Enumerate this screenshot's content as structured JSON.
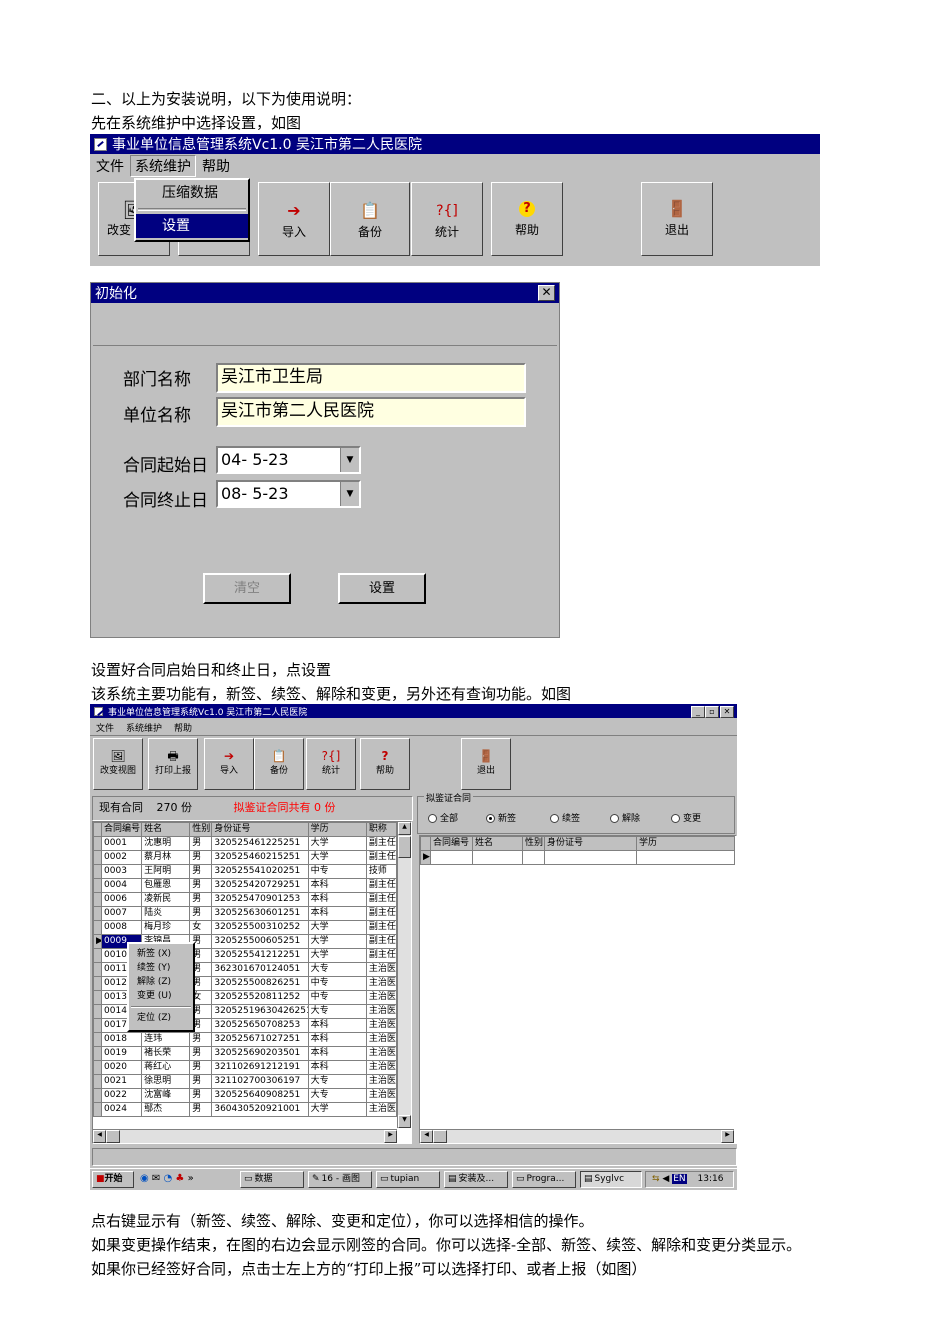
{
  "paragraphs": {
    "p1": "二、以上为安装说明，以下为使用说明：",
    "p2": "先在系统维护中选择设置，如图",
    "p3": "设置好合同启始日和终止日，点设置",
    "p4": "该系统主要功能有，新签、续签、解除和变更，另外还有查询功能。如图",
    "p5": "点右键显示有（新签、续签、解除、变更和定位），你可以选择相信的操作。",
    "p6": "如果变更操作结束，在图的右边会显示刚签的合同。你可以选择-全部、新签、续签、解除和变更分类显示。",
    "p7": "如果你已经签好合同，点击士左上方的“打印上报”可以选择打印、或者上报（如图）"
  },
  "shot1": {
    "title": "事业单位信息管理系统Vc1.0    吴江市第二人民医院",
    "menu": [
      "文件",
      "系统维护",
      "帮助"
    ],
    "dropdown": [
      "压缩数据",
      "设置"
    ],
    "toolbar": [
      {
        "label": "改变",
        "icon": "change-view-icon"
      },
      {
        "label": "导入",
        "icon": "import-icon"
      },
      {
        "label": "备份",
        "icon": "backup-icon"
      },
      {
        "label": "统计",
        "icon": "statistics-icon"
      },
      {
        "label": "帮助",
        "icon": "help-icon"
      },
      {
        "label": "退出",
        "icon": "exit-icon"
      }
    ]
  },
  "shot2": {
    "title": "初始化",
    "dept_label": "部门名称",
    "dept_value": "吴江市卫生局",
    "unit_label": "单位名称",
    "unit_value": "吴江市第二人民医院",
    "start_label": "合同起始日",
    "start_value": "04- 5-23",
    "end_label": "合同终止日",
    "end_value": "08- 5-23",
    "btn_clear": "清空",
    "btn_set": "设置"
  },
  "shot3": {
    "title": "事业单位信息管理系统Vc1.0    吴江市第二人民医院",
    "menu": [
      "文件",
      "系统维护",
      "帮助"
    ],
    "toolbar": [
      {
        "label": "改变视图",
        "icon": "change-view-icon"
      },
      {
        "label": "打印上报",
        "icon": "print-icon"
      },
      {
        "label": "导入",
        "icon": "import-icon"
      },
      {
        "label": "备份",
        "icon": "backup-icon"
      },
      {
        "label": "统计",
        "icon": "statistics-icon"
      },
      {
        "label": "帮助",
        "icon": "help-icon"
      },
      {
        "label": "退出",
        "icon": "exit-icon"
      }
    ],
    "count_prefix": "现有合同",
    "count_value": "270",
    "count_suffix": "份",
    "draft_text": "拟鉴证合同共有 0 份",
    "group_title": "拟鉴证合同",
    "radios": [
      {
        "label": "全部",
        "checked": false
      },
      {
        "label": "新签",
        "checked": true
      },
      {
        "label": "续签",
        "checked": false
      },
      {
        "label": "解除",
        "checked": false
      },
      {
        "label": "变更",
        "checked": false
      }
    ],
    "left_headers": [
      "合同编号",
      "姓名",
      "性别",
      "身份证号",
      "学历",
      "职称"
    ],
    "right_headers": [
      "合同编号",
      "姓名",
      "性别",
      "身份证号",
      "学历"
    ],
    "rows": [
      [
        "0001",
        "沈惠明",
        "男",
        "320525461225251",
        "大学",
        "副主任"
      ],
      [
        "0002",
        "蔡月林",
        "男",
        "320525460215251",
        "大学",
        "副主任"
      ],
      [
        "0003",
        "王阿明",
        "男",
        "320525541020251",
        "中专",
        "技师"
      ],
      [
        "0004",
        "包雁恩",
        "男",
        "320525420729251",
        "本科",
        "副主任"
      ],
      [
        "0006",
        "凌新民",
        "男",
        "320525470901253",
        "本科",
        "副主任"
      ],
      [
        "0007",
        "陆炎",
        "男",
        "320525630601251",
        "本科",
        "副主任"
      ],
      [
        "0008",
        "梅月珍",
        "女",
        "320525500310252",
        "大学",
        "副主任"
      ],
      [
        "0009",
        "李锦昌",
        "男",
        "320525500605251",
        "大学",
        "副主任"
      ],
      [
        "0010",
        "",
        "男",
        "320525541212251",
        "大学",
        "副主任"
      ],
      [
        "0011",
        "",
        "男",
        "362301670124051",
        "大专",
        "主治医"
      ],
      [
        "0012",
        "",
        "男",
        "320525500826251",
        "中专",
        "主治医"
      ],
      [
        "0013",
        "",
        "女",
        "320525520811252",
        "中专",
        "主治医"
      ],
      [
        "0014",
        "",
        "男",
        "32052519630426251",
        "大专",
        "主治医"
      ],
      [
        "0017",
        "沈慕联",
        "男",
        "320525650708253",
        "本科",
        "主治医"
      ],
      [
        "0018",
        "连玮",
        "男",
        "320525671027251",
        "本科",
        "主治医"
      ],
      [
        "0019",
        "褚长荣",
        "男",
        "320525690203501",
        "本科",
        "主治医"
      ],
      [
        "0020",
        "蒋红心",
        "男",
        "321102691212191",
        "本科",
        "主治医"
      ],
      [
        "0021",
        "徐思明",
        "男",
        "321102700306197",
        "大专",
        "主治医"
      ],
      [
        "0022",
        "沈富峰",
        "男",
        "320525640908251",
        "大专",
        "主治医"
      ],
      [
        "0024",
        "鄢杰",
        "男",
        "360430520921001",
        "大学",
        "主治医"
      ]
    ],
    "context_menu": [
      "新签 (X)",
      "续签 (Y)",
      "解除 (Z)",
      "变更 (U)",
      "定位 (Z)"
    ],
    "taskbar": {
      "start": "开始",
      "tasks": [
        "数据",
        "16 - 画图",
        "tupian",
        "安装及...",
        "Progra...",
        "Syglvc"
      ],
      "lang": "EN",
      "clock": "13:16"
    }
  },
  "colors": {
    "titlebar": "#000080",
    "face": "#c0c0c0",
    "field": "#ffffe1",
    "alert": "#ff0000"
  }
}
